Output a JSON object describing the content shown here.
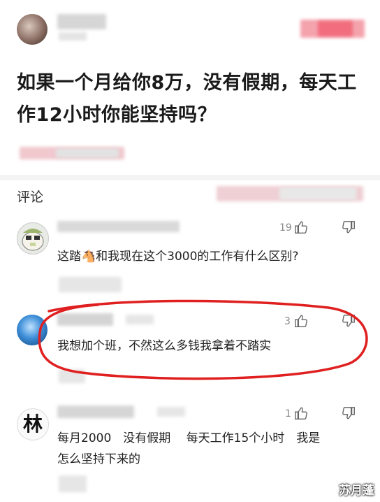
{
  "question": {
    "title": "如果一个月给你8万，没有假期，每天工作12小时你能坚持吗？"
  },
  "comments_section": {
    "title": "评论"
  },
  "comments": [
    {
      "likes": "19",
      "text": "这踏🐴和我现在这个3000的工作有什么区别?"
    },
    {
      "likes": "3",
      "text": "我想加个班，不然这么多钱我拿着不踏实"
    },
    {
      "likes": "1",
      "text_line1": "每月2000　没有假期　 每天工作15个小时　我是",
      "text_line2": "怎么坚持下来的",
      "avatar_text": "林"
    }
  ],
  "watermark": "苏月蓬",
  "colors": {
    "annotation_circle": "#e02020",
    "pink_button": "#f26d7d",
    "text": "#222222"
  }
}
